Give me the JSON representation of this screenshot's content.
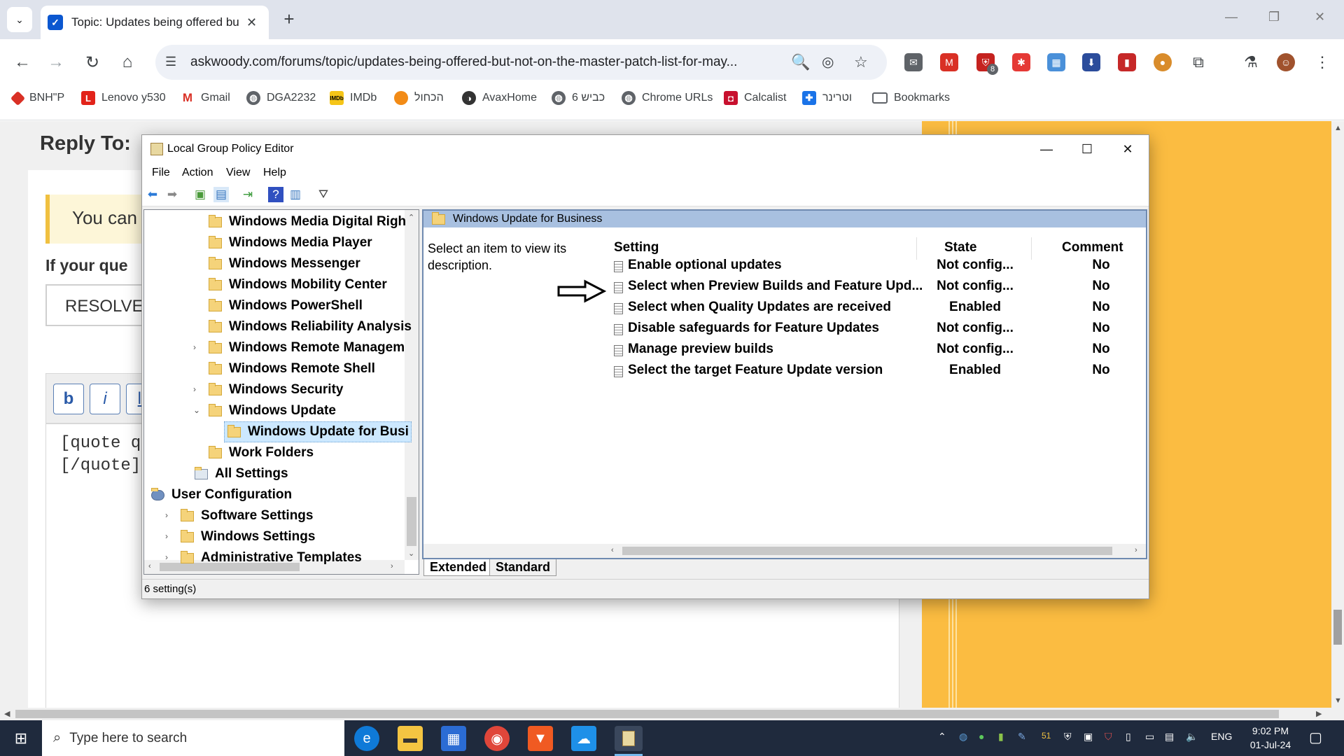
{
  "browser": {
    "tab_title": "Topic: Updates being offered but n",
    "url": "askwoody.com/forums/topic/updates-being-offered-but-not-on-the-master-patch-list-for-may...",
    "extension_badge": "8",
    "bookmarks": [
      {
        "label": "BNH\"P",
        "icon": "diamond-icon",
        "color": "#d93025"
      },
      {
        "label": "Lenovo y530",
        "icon": "lenovo-icon",
        "color": "#e2231a"
      },
      {
        "label": "Gmail",
        "icon": "gmail-icon",
        "color": "#d93025"
      },
      {
        "label": "DGA2232",
        "icon": "globe-icon",
        "color": "#5f6368"
      },
      {
        "label": "IMDb",
        "icon": "imdb-icon",
        "color": "#f5c518"
      },
      {
        "label": "הכחול",
        "icon": "chat-icon",
        "color": "#f28b16"
      },
      {
        "label": "AvaxHome",
        "icon": "avax-icon",
        "color": "#333333"
      },
      {
        "label": "6 כביש",
        "icon": "globe-icon",
        "color": "#5f6368"
      },
      {
        "label": "Chrome URLs",
        "icon": "globe-icon",
        "color": "#5f6368"
      },
      {
        "label": "Calcalist",
        "icon": "calcalist-icon",
        "color": "#c8102e"
      },
      {
        "label": "וטרינר",
        "icon": "vet-icon",
        "color": "#1a73e8"
      },
      {
        "label": "Bookmarks",
        "icon": "folder-icon",
        "color": "#5f6368"
      }
    ]
  },
  "webpage": {
    "reply_heading": "Reply To:",
    "notice_text": "You can",
    "if_question": "If your que",
    "resolve_text": "RESOLVE",
    "editor_buttons": [
      "b",
      "i",
      "li"
    ],
    "editor_lines": [
      "[quote qu",
      "[/quote]"
    ]
  },
  "gpedit": {
    "title": "Local Group Policy Editor",
    "menu": [
      "File",
      "Action",
      "View",
      "Help"
    ],
    "tree": [
      {
        "label": "Windows Media Digital Righ",
        "level": 1,
        "expander": ""
      },
      {
        "label": "Windows Media Player",
        "level": 1,
        "expander": ""
      },
      {
        "label": "Windows Messenger",
        "level": 1,
        "expander": ""
      },
      {
        "label": "Windows Mobility Center",
        "level": 1,
        "expander": ""
      },
      {
        "label": "Windows PowerShell",
        "level": 1,
        "expander": ""
      },
      {
        "label": "Windows Reliability Analysis",
        "level": 1,
        "expander": ""
      },
      {
        "label": "Windows Remote Managem",
        "level": 1,
        "expander": "›"
      },
      {
        "label": "Windows Remote Shell",
        "level": 1,
        "expander": ""
      },
      {
        "label": "Windows Security",
        "level": 1,
        "expander": "›"
      },
      {
        "label": "Windows Update",
        "level": 1,
        "expander": "⌄"
      },
      {
        "label": "Windows Update for Busi",
        "level": 2,
        "expander": "",
        "selected": true
      },
      {
        "label": "Work Folders",
        "level": 1,
        "expander": ""
      },
      {
        "label": "All Settings",
        "level": 0,
        "expander": ""
      },
      {
        "label": "User Configuration",
        "level": -2,
        "expander": "⌄"
      },
      {
        "label": "Software Settings",
        "level": -1,
        "expander": "›"
      },
      {
        "label": "Windows Settings",
        "level": -1,
        "expander": "›"
      },
      {
        "label": "Administrative Templates",
        "level": -1,
        "expander": "›"
      }
    ],
    "right_title": "Windows Update for Business",
    "description": "Select an item to view its description.",
    "columns": {
      "setting": "Setting",
      "state": "State",
      "comment": "Comment"
    },
    "settings": [
      {
        "name": "Enable optional updates",
        "state": "Not config...",
        "comment": "No"
      },
      {
        "name": "Select when Preview Builds and Feature Upd...",
        "state": "Not config...",
        "comment": "No",
        "arrow": true
      },
      {
        "name": "Select when Quality Updates are received",
        "state": "Enabled",
        "comment": "No"
      },
      {
        "name": "Disable safeguards for Feature Updates",
        "state": "Not config...",
        "comment": "No"
      },
      {
        "name": "Manage preview builds",
        "state": "Not config...",
        "comment": "No"
      },
      {
        "name": "Select the target Feature Update version",
        "state": "Enabled",
        "comment": "No"
      }
    ],
    "tabs": [
      "Extended",
      "Standard"
    ],
    "status": "6 setting(s)"
  },
  "taskbar": {
    "search_placeholder": "Type here to search",
    "tray_number": "51",
    "language": "ENG",
    "time": "9:02 PM",
    "date": "01-Jul-24"
  }
}
